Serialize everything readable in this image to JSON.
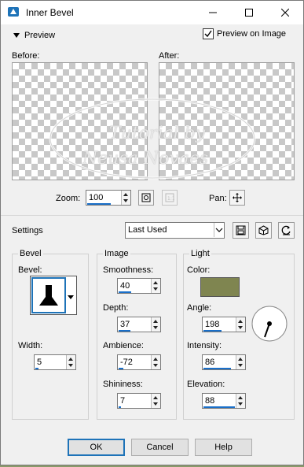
{
  "window": {
    "title": "Inner Bevel"
  },
  "preview": {
    "toggle_label": "Preview",
    "preview_on_image_label": "Preview on Image",
    "preview_on_image_checked": true
  },
  "panes": {
    "before_label": "Before:",
    "after_label": "After:"
  },
  "watermark": {
    "line1": "Tutorial by",
    "line2": "Neusa Novaes"
  },
  "zoom": {
    "label": "Zoom:",
    "value": "100",
    "pan_label": "Pan:"
  },
  "settings": {
    "label": "Settings",
    "preset": "Last Used"
  },
  "bevel": {
    "group_label": "Bevel",
    "bevel_label": "Bevel:",
    "width_label": "Width:",
    "width": "5",
    "width_level": 0.1
  },
  "image": {
    "group_label": "Image",
    "smoothness_label": "Smoothness:",
    "smoothness": "40",
    "smoothness_level": 0.4,
    "depth_label": "Depth:",
    "depth": "37",
    "depth_level": 0.37,
    "ambience_label": "Ambience:",
    "ambience": "-72",
    "ambience_level": 0.14,
    "shininess_label": "Shininess:",
    "shininess": "7",
    "shininess_level": 0.07
  },
  "light": {
    "group_label": "Light",
    "color_label": "Color:",
    "color": "#7f8550",
    "angle_label": "Angle:",
    "angle": "198",
    "angle_level": 0.55,
    "intensity_label": "Intensity:",
    "intensity": "86",
    "intensity_level": 0.86,
    "elevation_label": "Elevation:",
    "elevation": "88",
    "elevation_level": 0.98
  },
  "buttons": {
    "ok": "OK",
    "cancel": "Cancel",
    "help": "Help"
  }
}
